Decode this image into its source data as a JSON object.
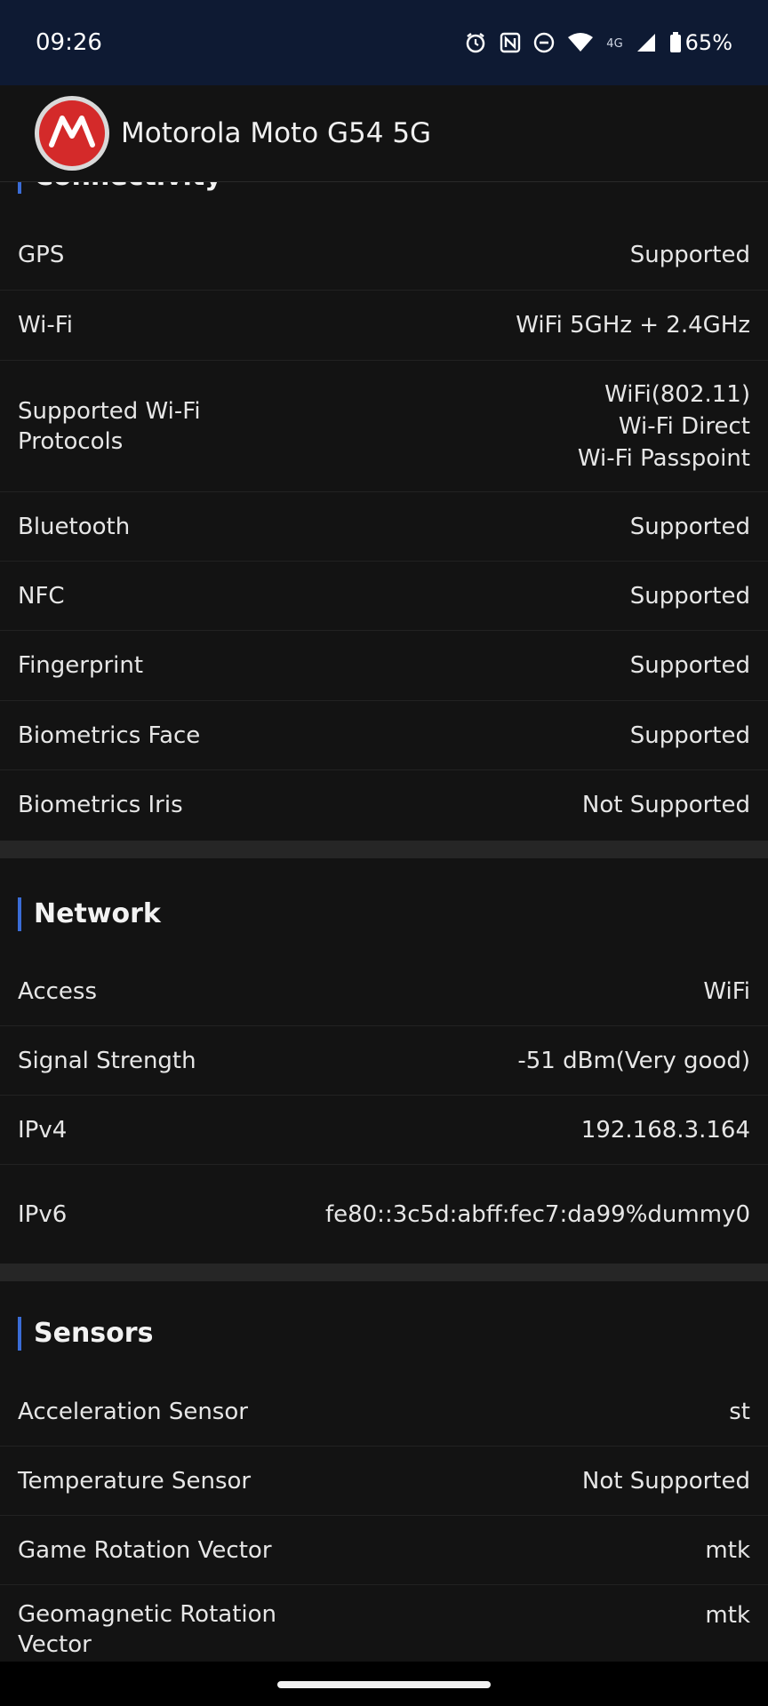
{
  "status_bar": {
    "time": "09:26",
    "network_type": "4G",
    "battery": "65%"
  },
  "header": {
    "title": "Motorola Moto G54 5G",
    "logo_color": "#d42a2a"
  },
  "connectivity": {
    "title": "Connectivity",
    "rows": [
      {
        "label": "GPS",
        "value": "Supported"
      },
      {
        "label": "Wi-Fi",
        "value": "WiFi 5GHz + 2.4GHz"
      },
      {
        "label": "Supported Wi-Fi Protocols",
        "values": [
          "WiFi(802.11)",
          "Wi-Fi Direct",
          "Wi-Fi Passpoint"
        ]
      },
      {
        "label": "Bluetooth",
        "value": "Supported"
      },
      {
        "label": "NFC",
        "value": "Supported"
      },
      {
        "label": "Fingerprint",
        "value": "Supported"
      },
      {
        "label": "Biometrics Face",
        "value": "Supported"
      },
      {
        "label": "Biometrics Iris",
        "value": "Not Supported"
      }
    ]
  },
  "network": {
    "title": "Network",
    "rows": [
      {
        "label": "Access",
        "value": "WiFi"
      },
      {
        "label": "Signal Strength",
        "value": "-51 dBm(Very good)"
      },
      {
        "label": "IPv4",
        "value": "192.168.3.164"
      },
      {
        "label": "IPv6",
        "value": "fe80::3c5d:abff:fec7:da99%dummy0"
      }
    ]
  },
  "sensors": {
    "title": "Sensors",
    "rows": [
      {
        "label": "Acceleration Sensor",
        "value": "st"
      },
      {
        "label": "Temperature Sensor",
        "value": "Not Supported"
      },
      {
        "label": "Game Rotation Vector",
        "value": "mtk"
      },
      {
        "label": "Geomagnetic Rotation Vector",
        "value": "mtk"
      }
    ]
  },
  "colors": {
    "status_bar_bg": "#0e1a33",
    "accent": "#3a6cd6",
    "background": "#131313"
  }
}
